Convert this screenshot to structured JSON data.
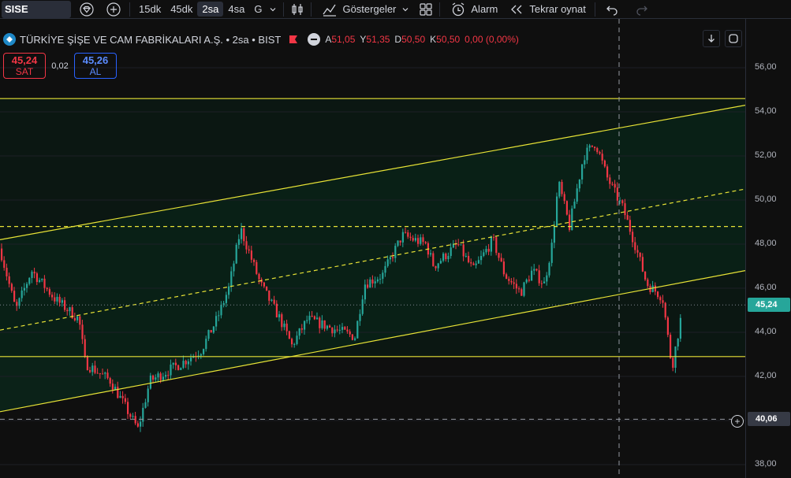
{
  "toolbar": {
    "symbol": "SISE",
    "intervals": [
      "15dk",
      "45dk",
      "2sa",
      "4sa",
      "G"
    ],
    "active_interval": "2sa",
    "indicators_label": "Göstergeler",
    "alarm_label": "Alarm",
    "replay_label": "Tekrar oynat"
  },
  "legend": {
    "title": "TÜRKİYE ŞİŞE VE CAM FABRİKALARI A.Ş. • 2sa • BIST",
    "open_label": "A",
    "open": "51,05",
    "high_label": "Y",
    "high": "51,35",
    "low_label": "D",
    "low": "50,50",
    "close_label": "K",
    "close": "50,50",
    "change": "0,00 (0,00%)"
  },
  "trade": {
    "sell_price": "45,24",
    "sell_label": "SAT",
    "spread": "0,02",
    "buy_price": "45,26",
    "buy_label": "AL"
  },
  "price_axis": {
    "ticks": [
      "56,00",
      "54,00",
      "52,00",
      "50,00",
      "48,00",
      "46,00",
      "44,00",
      "42,00",
      "40,00",
      "38,00"
    ],
    "tick_values": [
      56,
      54,
      52,
      50,
      48,
      46,
      44,
      42,
      40,
      38
    ],
    "last_price": "45,24",
    "last_price_value": 45.24,
    "crosshair_price": "40,06",
    "crosshair_value": 40.06
  },
  "colors": {
    "up": "#26a69a",
    "down": "#f23645",
    "lines": "#e8e336",
    "channel_fill": "#0b2a1c",
    "background": "#0f0f0f"
  },
  "drawings": {
    "horizontal_levels": [
      54.6,
      48.8,
      42.9
    ],
    "channel": {
      "top_left": 48.2,
      "top_right": 54.3,
      "mid_left": 44.1,
      "mid_right": 50.5,
      "bottom_left": 40.4,
      "bottom_right": 46.8
    }
  }
}
